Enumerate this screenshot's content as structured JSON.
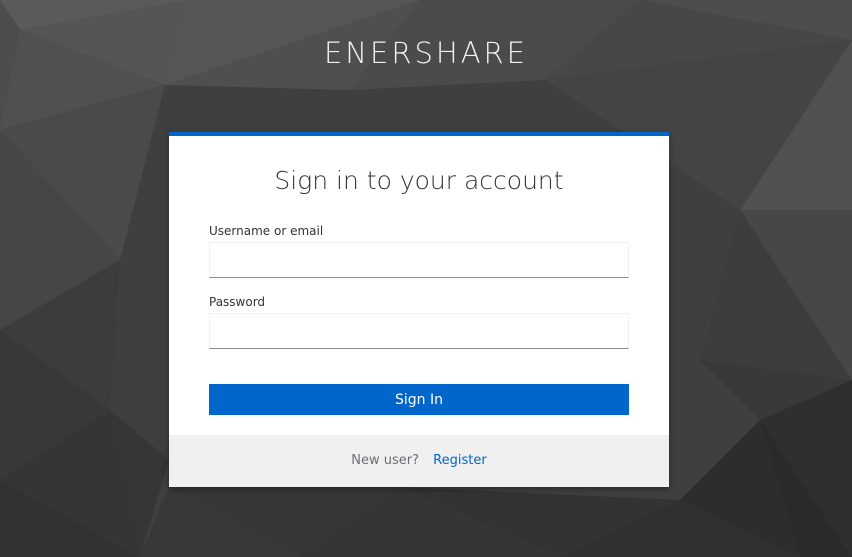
{
  "brand": {
    "name": "ENERSHARE"
  },
  "login_card": {
    "title": "Sign in to your account",
    "username_label": "Username or email",
    "username_value": "",
    "password_label": "Password",
    "password_value": "",
    "submit_label": "Sign In",
    "accent_color": "#0066cc"
  },
  "footer": {
    "new_user_text": "New user?",
    "register_label": "Register"
  }
}
